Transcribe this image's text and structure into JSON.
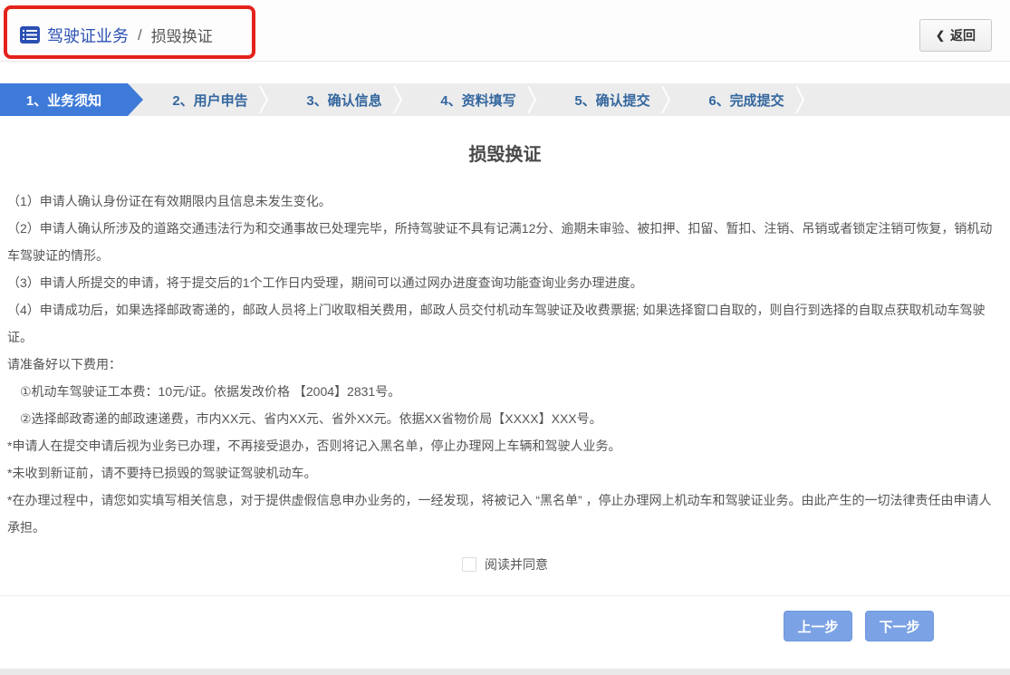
{
  "header": {
    "breadcrumb": {
      "section": "驾驶证业务",
      "separator": "/",
      "page": "损毁换证"
    },
    "back": {
      "chevron": "❮",
      "label": "返回"
    }
  },
  "steps": {
    "items": [
      {
        "label": "1、业务须知",
        "active": true
      },
      {
        "label": "2、用户申告",
        "active": false
      },
      {
        "label": "3、确认信息",
        "active": false
      },
      {
        "label": "4、资料填写",
        "active": false
      },
      {
        "label": "5、确认提交",
        "active": false
      },
      {
        "label": "6、完成提交",
        "active": false
      }
    ]
  },
  "content": {
    "title": "损毁换证",
    "paragraphs": [
      "（1）申请人确认身份证在有效期限内且信息未发生变化。",
      "（2）申请人确认所涉及的道路交通违法行为和交通事故已处理完毕，所持驾驶证不具有记满12分、逾期未审验、被扣押、扣留、暂扣、注销、吊销或者锁定注销可恢复，销机动车驾驶证的情形。",
      "（3）申请人所提交的申请，将于提交后的1个工作日内受理，期间可以通过网办进度查询功能查询业务办理进度。",
      "（4）申请成功后，如果选择邮政寄递的，邮政人员将上门收取相关费用，邮政人员交付机动车驾驶证及收费票据; 如果选择窗口自取的，则自行到选择的自取点获取机动车驾驶证。",
      "请准备好以下费用：",
      "　①机动车驾驶证工本费：10元/证。依据发改价格 【2004】2831号。",
      "　②选择邮政寄递的邮政速递费，市内XX元、省内XX元、省外XX元。依据XX省物价局【XXXX】XXX号。",
      "*申请人在提交申请后视为业务已办理，不再接受退办，否则将记入黑名单，停止办理网上车辆和驾驶人业务。",
      "*未收到新证前，请不要持已损毁的驾驶证驾驶机动车。",
      "*在办理过程中，请您如实填写相关信息，对于提供虚假信息申办业务的，一经发现，将被记入 “黑名单” ，停止办理网上机动车和驾驶证业务。由此产生的一切法律责任由申请人承担。"
    ]
  },
  "agreement": {
    "label": "阅读并同意",
    "checked": false
  },
  "footer": {
    "prev_label": "上一步",
    "next_label": "下一步"
  },
  "colors": {
    "top_rule": "#1d3a70",
    "breadcrumb_blue": "#2b50b4",
    "step_active_bg": "#3e7ad8",
    "step_bar_bg": "#ececec",
    "step_text_blue": "#34679f",
    "annotation_red": "#e3231b",
    "button_blue": "#7ba2e4",
    "body_text": "#555555"
  }
}
